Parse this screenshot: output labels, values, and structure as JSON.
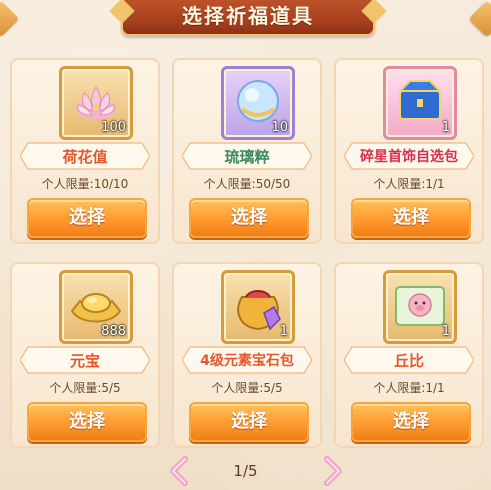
{
  "title": "选择祈福道具",
  "items": [
    {
      "name": "荷花值",
      "qty": "100",
      "limit": "个人限量:10/10",
      "button": "选择",
      "icon": "lotus-icon"
    },
    {
      "name": "琉璃粹",
      "qty": "10",
      "limit": "个人限量:50/50",
      "button": "选择",
      "icon": "crystal-orb-icon"
    },
    {
      "name": "碎星首饰自选包",
      "qty": "1",
      "limit": "个人限量:1/1",
      "button": "选择",
      "icon": "jewel-box-icon"
    },
    {
      "name": "元宝",
      "qty": "888",
      "limit": "个人限量:5/5",
      "button": "选择",
      "icon": "gold-ingot-icon"
    },
    {
      "name": "4级元素宝石包",
      "qty": "1",
      "limit": "个人限量:5/5",
      "button": "选择",
      "icon": "gem-bag-icon"
    },
    {
      "name": "丘比",
      "qty": "1",
      "limit": "个人限量:1/1",
      "button": "选择",
      "icon": "pig-scroll-icon"
    }
  ],
  "pager": {
    "text": "1/5"
  },
  "colors": {
    "accent": "#f07d17",
    "name_text": "#e4572b"
  }
}
